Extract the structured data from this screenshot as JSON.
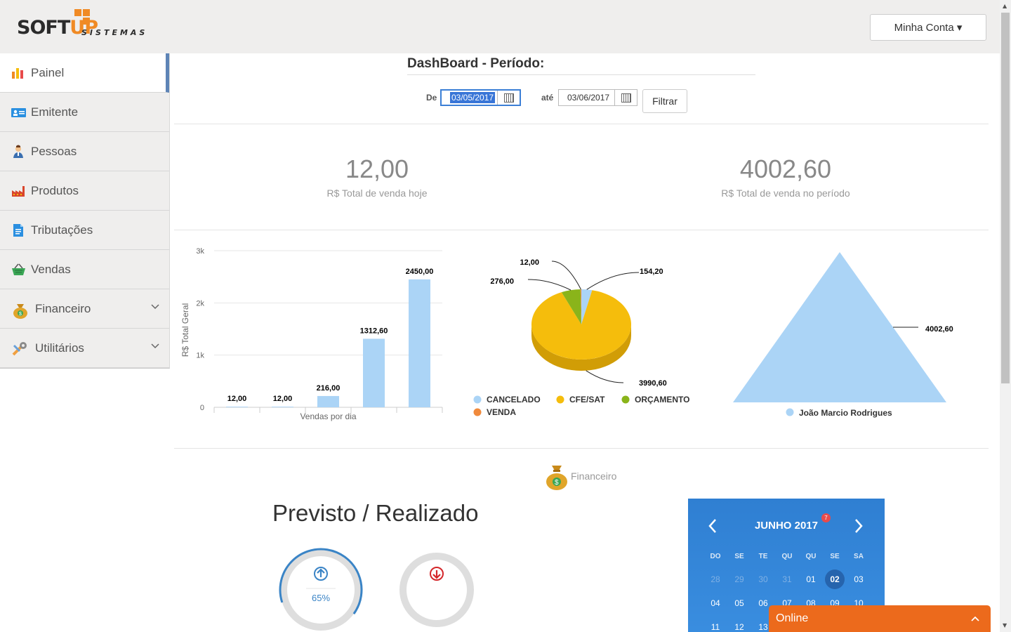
{
  "header": {
    "logo_soft": "SOFT",
    "logo_up": "UP",
    "logo_sistemas": "SISTEMAS",
    "account_label": "Minha Conta ▾"
  },
  "sidebar": {
    "items": [
      {
        "label": "Painel",
        "icon": "bar-chart-icon",
        "active": true
      },
      {
        "label": "Emitente",
        "icon": "id-card-icon"
      },
      {
        "label": "Pessoas",
        "icon": "person-icon"
      },
      {
        "label": "Produtos",
        "icon": "factory-icon"
      },
      {
        "label": "Tributações",
        "icon": "document-icon"
      },
      {
        "label": "Vendas",
        "icon": "basket-icon"
      },
      {
        "label": "Financeiro",
        "icon": "money-bag-icon",
        "expandable": true
      },
      {
        "label": "Utilitários",
        "icon": "tools-icon",
        "expandable": true
      }
    ]
  },
  "dashboard": {
    "title": "DashBoard - Período:",
    "from_label": "De",
    "from_value": "03/05/2017",
    "to_label": "até",
    "to_value": "03/06/2017",
    "filter_label": "Filtrar"
  },
  "stats": {
    "today_value": "12,00",
    "today_label": "R$ Total de venda hoje",
    "period_value": "4002,60",
    "period_label": "R$ Total de venda no período"
  },
  "chart_data": [
    {
      "type": "bar",
      "xlabel": "Vendas por dia",
      "ylabel": "R$ Total Geral",
      "ylim": [
        0,
        3000
      ],
      "yticks": [
        "0",
        "1k",
        "2k",
        "3k"
      ],
      "values": [
        12.0,
        12.0,
        216.0,
        1312.6,
        2450.0
      ],
      "data_labels": [
        "12,00",
        "12,00",
        "216,00",
        "1312,60",
        "2450,00"
      ],
      "color": "#abd4f6",
      "grid": true
    },
    {
      "type": "pie",
      "slices": [
        {
          "name": "CANCELADO",
          "value": 154.2,
          "label": "154,20",
          "color": "#abd4f6"
        },
        {
          "name": "CFE/SAT",
          "value": 3990.6,
          "label": "3990,60",
          "color": "#f5bd0c"
        },
        {
          "name": "ORÇAMENTO",
          "value": 276.0,
          "label": "276,00",
          "color": "#8ab41a"
        },
        {
          "name": "VENDA",
          "value": 12.0,
          "label": "12,00",
          "color": "#f08a3c"
        }
      ],
      "legend_placement": "bottom"
    },
    {
      "type": "pyramid",
      "series": [
        {
          "name": "João Marcio Rodrigues",
          "value": 4002.6,
          "label": "4002,60",
          "color": "#abd4f6"
        }
      ],
      "legend_placement": "bottom"
    }
  ],
  "financeiro": {
    "section_label": "Financeiro",
    "title": "Previsto / Realizado",
    "gauge_up_percent": "65%",
    "gauge_up_fraction": 0.65,
    "gauge_down_fraction": 0
  },
  "calendar": {
    "month": "JUNHO 2017",
    "badge": "7",
    "weekdays": [
      "DO",
      "SE",
      "TE",
      "QU",
      "QU",
      "SE",
      "SA"
    ],
    "days": [
      "28",
      "29",
      "30",
      "31",
      "01",
      "02",
      "03",
      "04",
      "05",
      "06",
      "07",
      "08",
      "09",
      "10",
      "11",
      "12",
      "13"
    ],
    "today": "02"
  },
  "chat": {
    "label": "Online"
  },
  "colors": {
    "accent": "#5e84b6",
    "orange": "#ec6a1c",
    "bar": "#abd4f6"
  }
}
